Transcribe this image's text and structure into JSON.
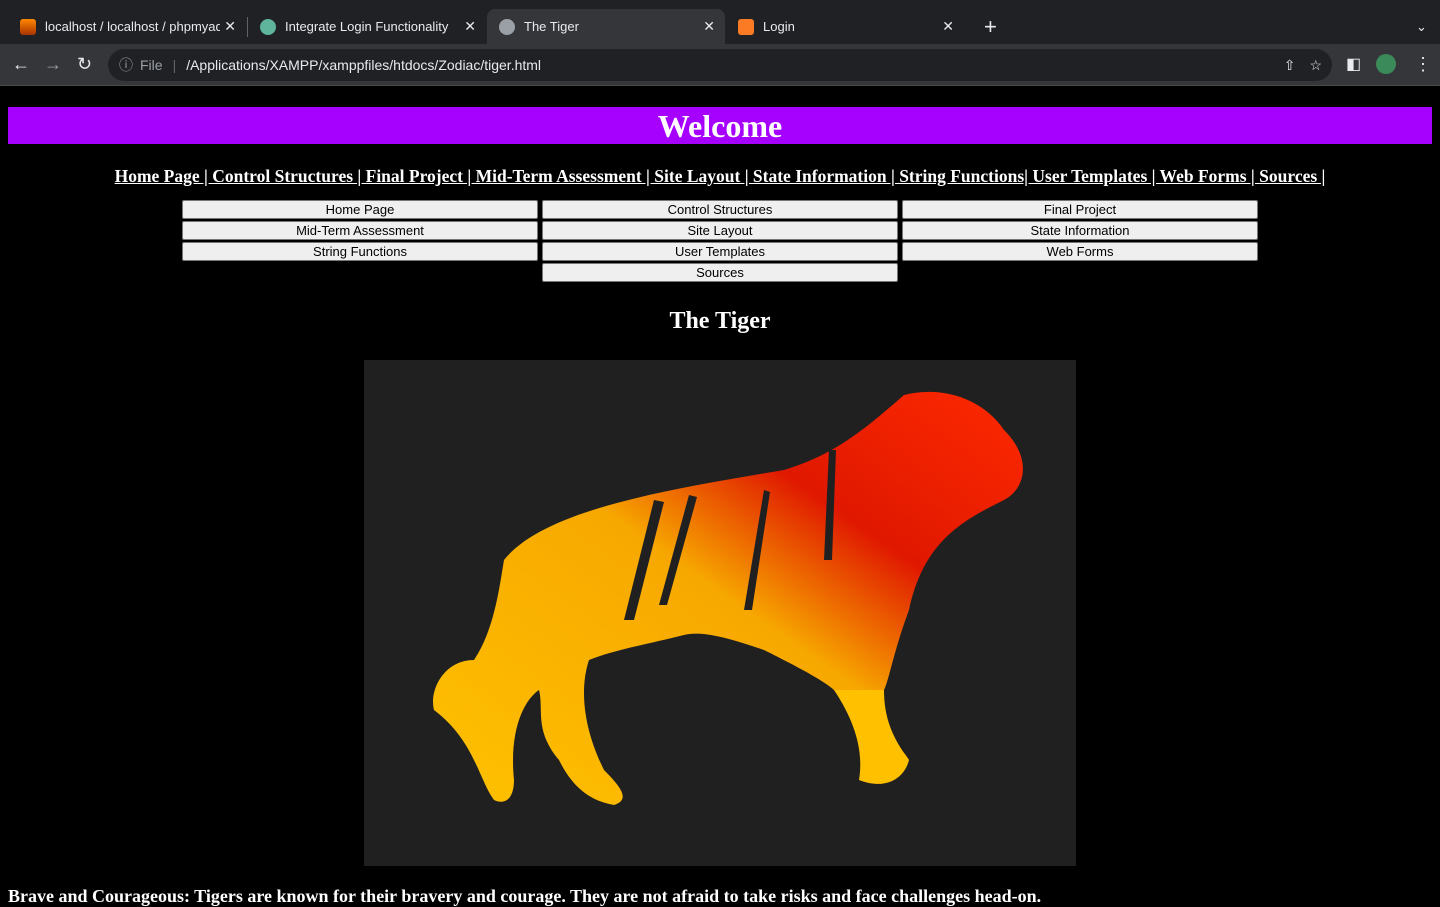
{
  "browser": {
    "tabs": [
      {
        "title": "localhost / localhost / phpmyad",
        "icon": "phpmyadmin-icon"
      },
      {
        "title": "Integrate Login Functionality",
        "icon": "chatgpt-icon"
      },
      {
        "title": "The Tiger",
        "icon": "globe-icon",
        "active": true
      },
      {
        "title": "Login",
        "icon": "xampp-icon"
      }
    ],
    "file_label": "File",
    "url": "/Applications/XAMPP/xamppfiles/htdocs/Zodiac/tiger.html"
  },
  "page": {
    "banner": "Welcome",
    "links_text": "Home Page | Control Structures | Final Project | Mid-Term Assessment | Site Layout | State Information | String Functions| User Templates | Web Forms | Sources |",
    "buttons": [
      "Home Page",
      "Control Structures",
      "Final Project",
      "Mid-Term Assessment",
      "Site Layout",
      "State Information",
      "String Functions",
      "User Templates",
      "Web Forms",
      "Sources"
    ],
    "heading": "The Tiger",
    "paragraph": "Brave and Courageous: Tigers are known for their bravery and courage. They are not afraid to take risks and face challenges head-on."
  },
  "colors": {
    "banner": "#a600ff"
  }
}
